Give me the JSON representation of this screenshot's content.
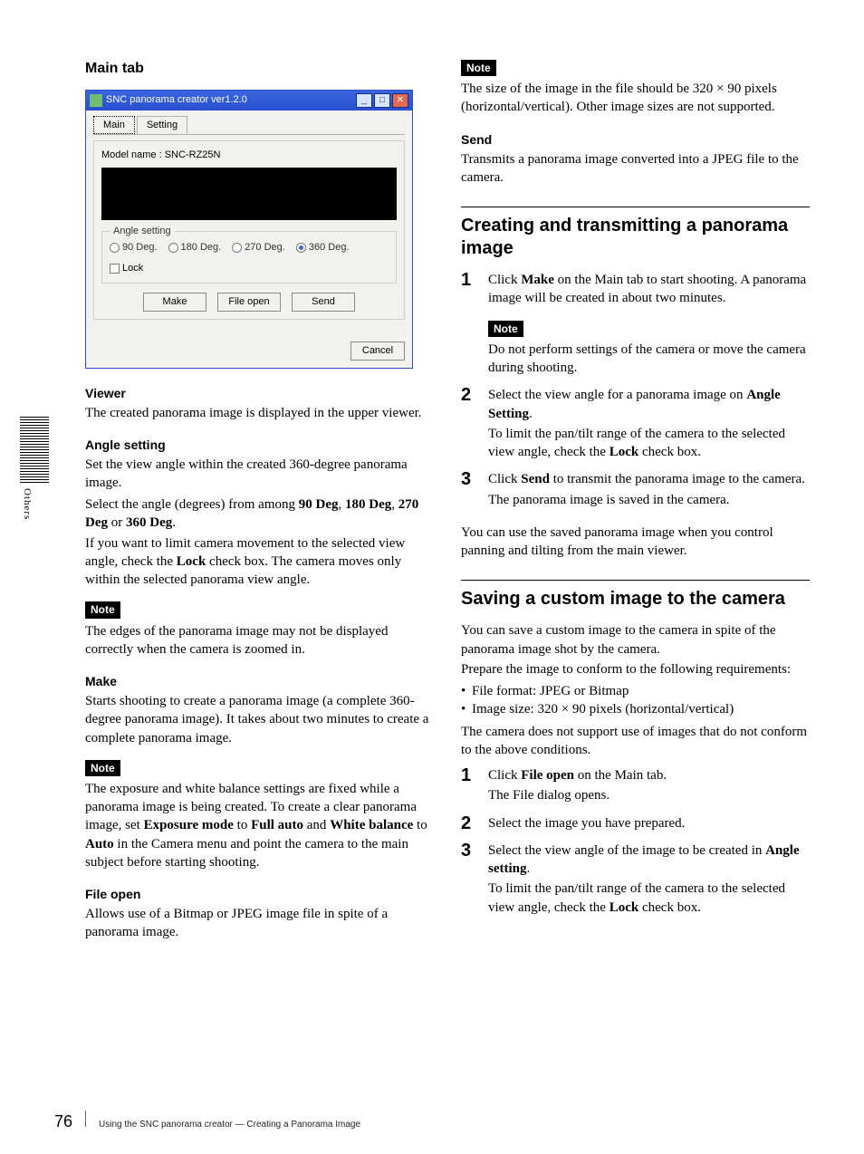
{
  "left": {
    "mainTabHeading": "Main tab",
    "window": {
      "title": "SNC panorama creator ver1.2.0",
      "tabs": {
        "main": "Main",
        "setting": "Setting"
      },
      "model_label": "Model name :  SNC-RZ25N",
      "angle_legend": "Angle setting",
      "radios": {
        "r90": "90 Deg.",
        "r180": "180 Deg.",
        "r270": "270 Deg.",
        "r360": "360 Deg."
      },
      "lock": "Lock",
      "buttons": {
        "make": "Make",
        "fileopen": "File open",
        "send": "Send",
        "cancel": "Cancel"
      }
    },
    "viewer_h": "Viewer",
    "viewer_p": "The created panorama image is displayed in the upper viewer.",
    "angle_h": "Angle setting",
    "angle_p1": "Set the view angle within the created 360-degree panorama image.",
    "angle_p2a": "Select the angle (degrees) from among ",
    "angle_b1": "90 Deg",
    "angle_c1": ", ",
    "angle_b2": "180 Deg",
    "angle_c2": ", ",
    "angle_b3": "270 Deg",
    "angle_c3": " or ",
    "angle_b4": "360 Deg",
    "angle_c4": ".",
    "angle_p3a": "If you want to limit camera movement to the selected view angle, check the ",
    "angle_p3b": "Lock",
    "angle_p3c": " check box. The camera moves only within the selected panorama view angle.",
    "note_label": "Note",
    "angle_note": "The edges of the panorama image may not be displayed correctly when the camera is zoomed in.",
    "make_h": "Make",
    "make_p": "Starts shooting to create a panorama image (a complete 360-degree panorama image). It takes about two minutes to create a complete panorama image.",
    "make_note_a": "The exposure and white balance settings are fixed while a panorama image is being created. To create a clear panorama image, set ",
    "make_note_b1": "Exposure mode",
    "make_note_c1": " to ",
    "make_note_b2": "Full auto",
    "make_note_c2": " and ",
    "make_note_b3": "White balance",
    "make_note_c3": " to ",
    "make_note_b4": "Auto",
    "make_note_c4": " in the Camera menu and point the camera to the main subject before starting shooting.",
    "fileopen_h": "File open",
    "fileopen_p": "Allows use of a Bitmap or JPEG image file in spite of a panorama image."
  },
  "right": {
    "size_note": "The size of the image in the file should be 320 × 90 pixels (horizontal/vertical). Other image sizes are not supported.",
    "send_h": "Send",
    "send_p": "Transmits a panorama image converted into a JPEG file to the camera.",
    "creating_h": "Creating and transmitting a panorama image",
    "step1_a": "Click ",
    "step1_b": "Make",
    "step1_c": " on the Main tab to start shooting. A panorama image will be created in about two minutes.",
    "step1_note": "Do not perform settings of the camera or move the camera during shooting.",
    "step2_a": "Select the view angle for a panorama image on ",
    "step2_b": "Angle Setting",
    "step2_c": ".",
    "step2_d": "To limit the pan/tilt range of the camera to the selected view angle, check the ",
    "step2_e": "Lock",
    "step2_f": " check box.",
    "step3_a": "Click ",
    "step3_b": "Send",
    "step3_c": " to transmit the panorama image to the camera.",
    "step3_d": "The panorama image is saved in the camera.",
    "creating_tail": "You can use the saved panorama image when you control panning and tilting from the main viewer.",
    "saving_h": "Saving a custom image to the camera",
    "saving_p1": "You can save a custom image to the camera in spite of the panorama image shot by the camera.",
    "saving_p2": "Prepare the image to conform to the following requirements:",
    "saving_li1": "File format: JPEG or Bitmap",
    "saving_li2": "Image size:  320 × 90 pixels (horizontal/vertical)",
    "saving_p3": "The camera does not support use of images that do not conform to the above conditions.",
    "sstep1_a": "Click ",
    "sstep1_b": "File open",
    "sstep1_c": " on the Main tab.",
    "sstep1_d": "The File dialog opens.",
    "sstep2": "Select the image you have prepared.",
    "sstep3_a": "Select the view angle of the image to be created in ",
    "sstep3_b": "Angle setting",
    "sstep3_c": ".",
    "sstep3_d": "To limit the pan/tilt range of the camera to the selected view angle, check the ",
    "sstep3_e": "Lock",
    "sstep3_f": " check box."
  },
  "nums": {
    "s1": "1",
    "s2": "2",
    "s3": "3"
  },
  "side": {
    "label": "Others"
  },
  "footer": {
    "page": "76",
    "text": "Using the SNC panorama creator — Creating a Panorama Image"
  }
}
